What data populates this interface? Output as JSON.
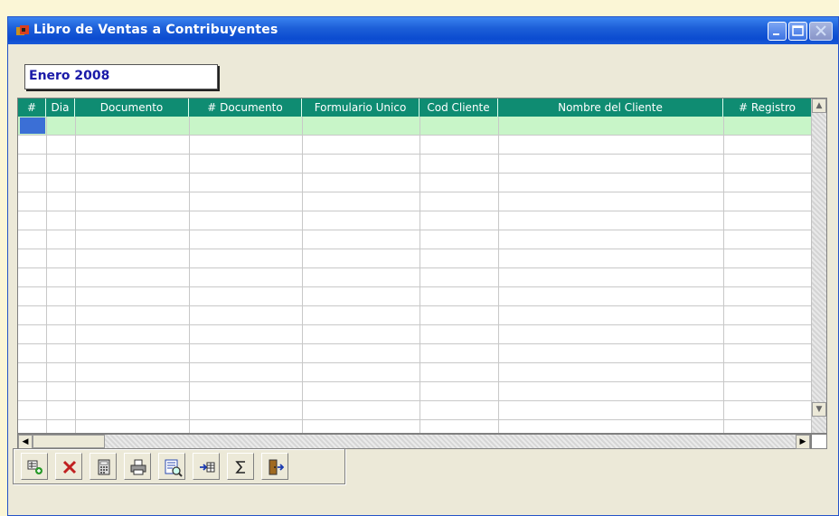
{
  "window": {
    "title": "Libro de Ventas a Contribuyentes",
    "controls": [
      "minimize",
      "maximize",
      "close"
    ]
  },
  "period": {
    "value": "Enero 2008"
  },
  "grid": {
    "columns": [
      "#",
      "Dia",
      "Documento",
      "# Documento",
      "Formulario Unico",
      "Cod Cliente",
      "Nombre del Cliente",
      "# Registro"
    ],
    "rows": [],
    "header_color": "#0f8c72",
    "selected_row_color": "#c8f5c8"
  },
  "toolbar": {
    "buttons": [
      {
        "icon": "add-record-icon"
      },
      {
        "icon": "delete-icon"
      },
      {
        "icon": "calculator-icon"
      },
      {
        "icon": "print-icon"
      },
      {
        "icon": "print-preview-icon"
      },
      {
        "icon": "import-icon"
      },
      {
        "icon": "sum-icon"
      },
      {
        "icon": "exit-icon"
      }
    ]
  }
}
